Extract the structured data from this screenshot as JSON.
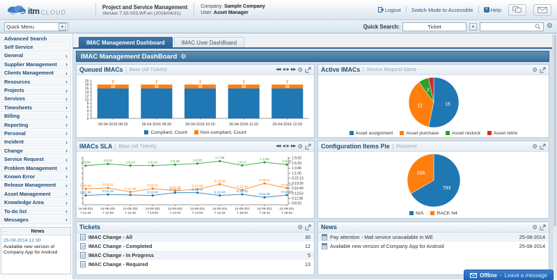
{
  "icons": {
    "gear": "⚙",
    "caret_down": "▾",
    "chevron_right": "›",
    "nav_first": "◀◀",
    "nav_prev": "◀",
    "nav_next": "▶",
    "nav_last": "▶▶"
  },
  "header": {
    "logo_itm": "itm",
    "logo_cloud": "CLOUD",
    "app_title": "Project and Service Management",
    "version": "Version 7.53.003.WF.en (2016/04/21)",
    "company_label": "Company:",
    "company": "Sample Company",
    "user_label": "User:",
    "user": "Asset Manager",
    "links": {
      "logout": "Logout",
      "accessible": "Switch Mode to Accessible",
      "help": "Help"
    }
  },
  "quickbar": {
    "quick_menu_label": "Quick Menu",
    "quick_search_label": "Quick Search:",
    "search_type": "Ticket",
    "search_value": ""
  },
  "sidebar": {
    "items": [
      {
        "label": "Advanced Search",
        "expandable": false
      },
      {
        "label": "Self Service",
        "expandable": false
      },
      {
        "label": "General",
        "expandable": true
      },
      {
        "label": "Supplier Management",
        "expandable": true
      },
      {
        "label": "Clients Management",
        "expandable": true
      },
      {
        "label": "Resources",
        "expandable": true
      },
      {
        "label": "Projects",
        "expandable": true
      },
      {
        "label": "Services",
        "expandable": true
      },
      {
        "label": "Timesheets",
        "expandable": true
      },
      {
        "label": "Billing",
        "expandable": true
      },
      {
        "label": "Reporting",
        "expandable": true
      },
      {
        "label": "Personal",
        "expandable": true
      },
      {
        "label": "Incident",
        "expandable": true
      },
      {
        "label": "Change",
        "expandable": true
      },
      {
        "label": "Service Request",
        "expandable": true
      },
      {
        "label": "Problem Management",
        "expandable": true
      },
      {
        "label": "Known Error",
        "expandable": true
      },
      {
        "label": "Release Management",
        "expandable": true
      },
      {
        "label": "Asset Management",
        "expandable": true
      },
      {
        "label": "Knowledge Area",
        "expandable": true
      },
      {
        "label": "To-do list",
        "expandable": true
      },
      {
        "label": "Messages",
        "expandable": true
      }
    ],
    "news": {
      "dots": "...",
      "title": "News",
      "date": "25-08-2014 12:30",
      "text": "Available new version of Company App for Android"
    }
  },
  "tabs": [
    {
      "label": "IMAC Management Dashboard",
      "active": true
    },
    {
      "label": "IMAC User DashBoard",
      "active": false
    }
  ],
  "dashboard": {
    "title": "IMAC Management DashBoard"
  },
  "panels": {
    "queued": {
      "title": "Queued IMACs",
      "subtitle": "Base (All Tickets)"
    },
    "active": {
      "title": "Active IMACs",
      "subtitle": "Service Request Name"
    },
    "sla": {
      "title": "IMACs SLA",
      "subtitle": "Base (All Tickets)"
    },
    "config": {
      "title": "Configuration Items Pie",
      "subtitle": "Posizione"
    },
    "tickets": {
      "title": "Tickets",
      "rows": [
        {
          "label": "IMAC Change - All",
          "count": 30
        },
        {
          "label": "IMAC Change - Completed",
          "count": 12
        },
        {
          "label": "IMAC Change - In Progress",
          "count": 5
        },
        {
          "label": "IMAC Change - Required",
          "count": 13
        }
      ]
    },
    "news": {
      "title": "News",
      "rows": [
        {
          "text": "Pay attention - Mail service unavailable in WE",
          "date": "25-08-2014"
        },
        {
          "text": "Avaliable new version of Company App for Android",
          "date": "25-08-2014"
        }
      ]
    }
  },
  "chart_data": [
    {
      "panel": "queued_imacs",
      "type": "bar",
      "stacked": true,
      "title": "Queued IMACs",
      "categories": [
        "26-04-2016 08:20",
        "26-04-2016 09:20",
        "26-04-2016 10:20",
        "26-04-2016 11:20",
        "26-04-2016 12:20"
      ],
      "series": [
        {
          "name": "Compliant, Count",
          "color": "#1f77b4",
          "values": [
            16,
            16,
            16,
            16,
            16
          ]
        },
        {
          "name": "Non-compliant, Count",
          "color": "#ff7f0e",
          "values": [
            2,
            2,
            2,
            2,
            2
          ]
        }
      ],
      "ylim": [
        0,
        20
      ],
      "ytick_step": 2,
      "grid": false,
      "legend_position": "bottom"
    },
    {
      "panel": "active_imacs",
      "type": "pie",
      "title": "Active IMACs",
      "labels": [
        "Asset assignment",
        "Asset purchase",
        "Asset restock",
        "Asset retire"
      ],
      "values": [
        16,
        11,
        2,
        1
      ],
      "data_labels": [
        "16",
        "11",
        "2",
        ""
      ],
      "colors": [
        "#1f77b4",
        "#ff7f0e",
        "#2ca02c",
        "#d62728"
      ],
      "legend_position": "bottom"
    },
    {
      "panel": "imacs_sla",
      "type": "line",
      "title": "IMACs SLA",
      "x": [
        "14-09-2017 11:33",
        "14-09-2017 12:03",
        "14-09-2017 12:33",
        "14-09-2017 13:03",
        "14-09-2017 13:33",
        "14-09-2017 14:03",
        "14-09-2017 14:33",
        "14-09-2017 15:03",
        "14-09-2017 15:33",
        "14-09-2017 16:03"
      ],
      "y_axis_right_labels": [
        "1:9:20",
        "1:6:33",
        "1:3:46",
        "1:1:00",
        "0:22:13",
        "0:19:26",
        "0:16:40",
        "0:13:53",
        "0:11:06",
        "0:8:20"
      ],
      "value_format": "days:hours:minutes",
      "grid": false,
      "legend_position": "none",
      "series": [
        {
          "name": "sla-green",
          "color": "#2ca02c",
          "point_labels": [
            "1:5:09",
            "1:6:07",
            "1:5:14",
            "1:5:14",
            "1:5:45",
            "1:6:20",
            "1:7:39",
            "1:5:17",
            "1:7:02",
            "1:5:46"
          ]
        },
        {
          "name": "sla-orange",
          "color": "#ff7f0e",
          "point_labels": [
            "0:16:22",
            "0:16:52",
            "0:14:38",
            "0:16:31",
            "0:15:20",
            "0:16:06",
            "0:18:55",
            "0:15:44",
            "0:19:23",
            "0:16:48"
          ]
        },
        {
          "name": "sla-blue",
          "color": "#1f77b4",
          "point_labels": [
            "0:12:46",
            "0:13:15",
            null,
            "0:12:43",
            "0:14:15",
            "0:14:14",
            "0:12:43",
            "0:13:20",
            "0:11:39",
            "0:12:58"
          ]
        }
      ]
    },
    {
      "panel": "config_items",
      "type": "pie",
      "title": "Configuration Items Pie",
      "labels": [
        "N/A",
        "RACK N4"
      ],
      "values": [
        793,
        396
      ],
      "data_labels": [
        "793",
        "396"
      ],
      "colors": [
        "#1f77b4",
        "#ff7f0e"
      ],
      "legend_position": "bottom"
    }
  ],
  "offline": {
    "status": "Offline",
    "separator": "-",
    "message": "Leave a message"
  }
}
